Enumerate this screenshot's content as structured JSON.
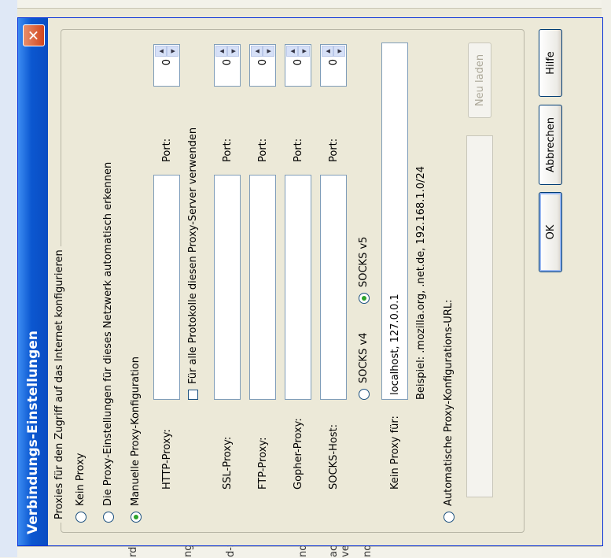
{
  "window": {
    "title": "Verbindungs-Einstellungen"
  },
  "group": {
    "legend": "Proxies für den Zugriff auf das Internet konfigurieren"
  },
  "options": {
    "no_proxy": "Kein Proxy",
    "auto_detect": "Die Proxy-Einstellungen für dieses Netzwerk automatisch erkennen",
    "manual": "Manuelle Proxy-Konfiguration",
    "auto_url": "Automatische Proxy-Konfigurations-URL:"
  },
  "manual": {
    "http_label": "HTTP-Proxy:",
    "http_value": "",
    "http_port_label": "Port:",
    "http_port": "0",
    "all_protocols": "Für alle Protokolle diesen Proxy-Server verwenden",
    "ssl_label": "SSL-Proxy:",
    "ssl_port_label": "Port:",
    "ssl_port": "0",
    "ftp_label": "FTP-Proxy:",
    "ftp_port_label": "Port:",
    "ftp_port": "0",
    "gopher_label": "Gopher-Proxy:",
    "gopher_port_label": "Port:",
    "gopher_port": "0",
    "socks_label": "SOCKS-Host:",
    "socks_port_label": "Port:",
    "socks_port": "0",
    "socks_v4": "SOCKS v4",
    "socks_v5": "SOCKS v5",
    "no_proxy_label": "Kein Proxy für:",
    "no_proxy_value": "localhost, 127.0.0.1",
    "example": "Beispiel: .mozilla.org, .net.de, 192.168.1.0/24"
  },
  "auto_url_value": "",
  "buttons": {
    "reload": "Neu laden",
    "ok": "OK",
    "cancel": "Abbrechen",
    "help": "Hilfe"
  },
  "background_fragments": [
    "rdu",
    "nge",
    "d-S",
    "nd",
    "ac",
    "ve",
    "nd"
  ]
}
